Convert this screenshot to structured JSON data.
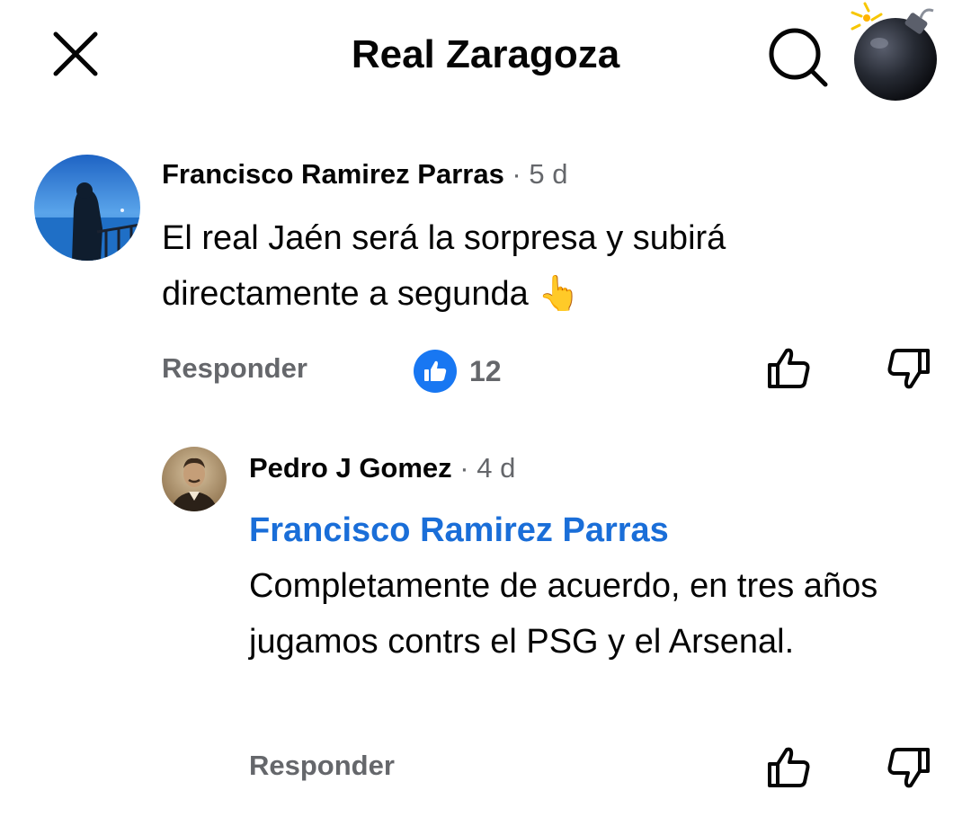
{
  "header": {
    "title": "Real Zaragoza",
    "close_icon": "close-icon",
    "search_icon": "search-icon",
    "profile_icon": "bomb-icon"
  },
  "comments": [
    {
      "author": "Francisco Ramirez Parras",
      "meta": " · 5 d",
      "text": "El real Jaén será la sorpresa y subirá directamente a segunda 👆",
      "reply_label": "Responder",
      "reaction_icon": "like-icon",
      "reaction_count": "12"
    }
  ],
  "replies": [
    {
      "author": "Pedro J Gomez",
      "meta": " · 4 d",
      "mention": "Francisco Ramirez Parras",
      "text": "Completamente de acuerdo, en tres años jugamos contrs el PSG y el Arsenal.",
      "reply_label": "Responder"
    }
  ],
  "colors": {
    "accent": "#1877f2",
    "mention": "#1a6ed8",
    "secondary_text": "#65676b"
  }
}
